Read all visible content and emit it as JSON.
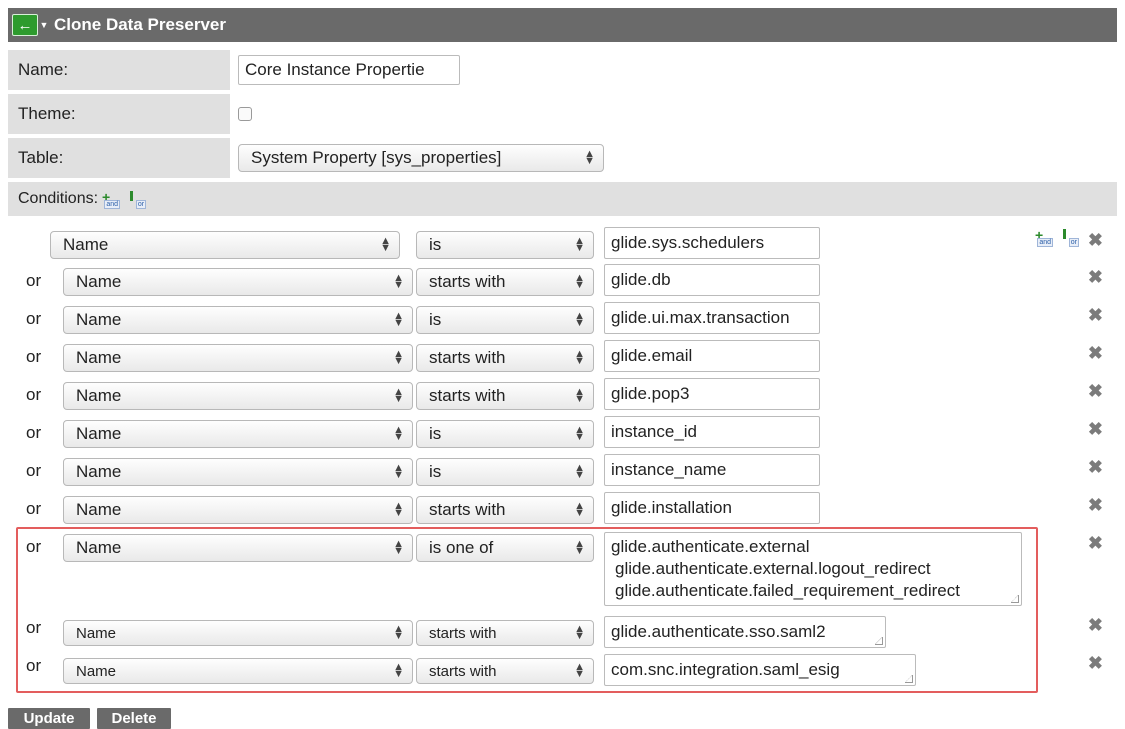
{
  "header": {
    "title": "Clone Data Preserver",
    "back_icon": "back-arrow-icon",
    "menu_icon": "chevron-down-icon",
    "accent_color": "#2e9b2e",
    "bar_color": "#6a6a6a"
  },
  "form": {
    "name_label": "Name:",
    "name_value": "Core Instance Propertie",
    "theme_label": "Theme:",
    "theme_checked": false,
    "table_label": "Table:",
    "table_value": "System Property [sys_properties]",
    "conditions_label": "Conditions:"
  },
  "conditions": [
    {
      "conj": "",
      "field": "Name",
      "operator": "is",
      "value": "glide.sys.schedulers"
    },
    {
      "conj": "or",
      "field": "Name",
      "operator": "starts with",
      "value": "glide.db"
    },
    {
      "conj": "or",
      "field": "Name",
      "operator": "is",
      "value": "glide.ui.max.transaction"
    },
    {
      "conj": "or",
      "field": "Name",
      "operator": "starts with",
      "value": "glide.email"
    },
    {
      "conj": "or",
      "field": "Name",
      "operator": "starts with",
      "value": "glide.pop3"
    },
    {
      "conj": "or",
      "field": "Name",
      "operator": "is",
      "value": "instance_id"
    },
    {
      "conj": "or",
      "field": "Name",
      "operator": "is",
      "value": "instance_name"
    },
    {
      "conj": "or",
      "field": "Name",
      "operator": "starts with",
      "value": "glide.installation"
    },
    {
      "conj": "or",
      "field": "Name",
      "operator": "is one of",
      "values": [
        "glide.authenticate.external",
        "glide.authenticate.external.logout_redirect",
        "glide.authenticate.failed_requirement_redirect"
      ]
    },
    {
      "conj": "or",
      "field": "Name",
      "operator": "starts with",
      "value": "glide.authenticate.sso.saml2"
    },
    {
      "conj": "or",
      "field": "Name",
      "operator": "starts with",
      "value": "com.snc.integration.saml_esig"
    }
  ],
  "buttons": {
    "update_label": "Update",
    "delete_label": "Delete"
  },
  "highlight_color": "#e35d5d"
}
